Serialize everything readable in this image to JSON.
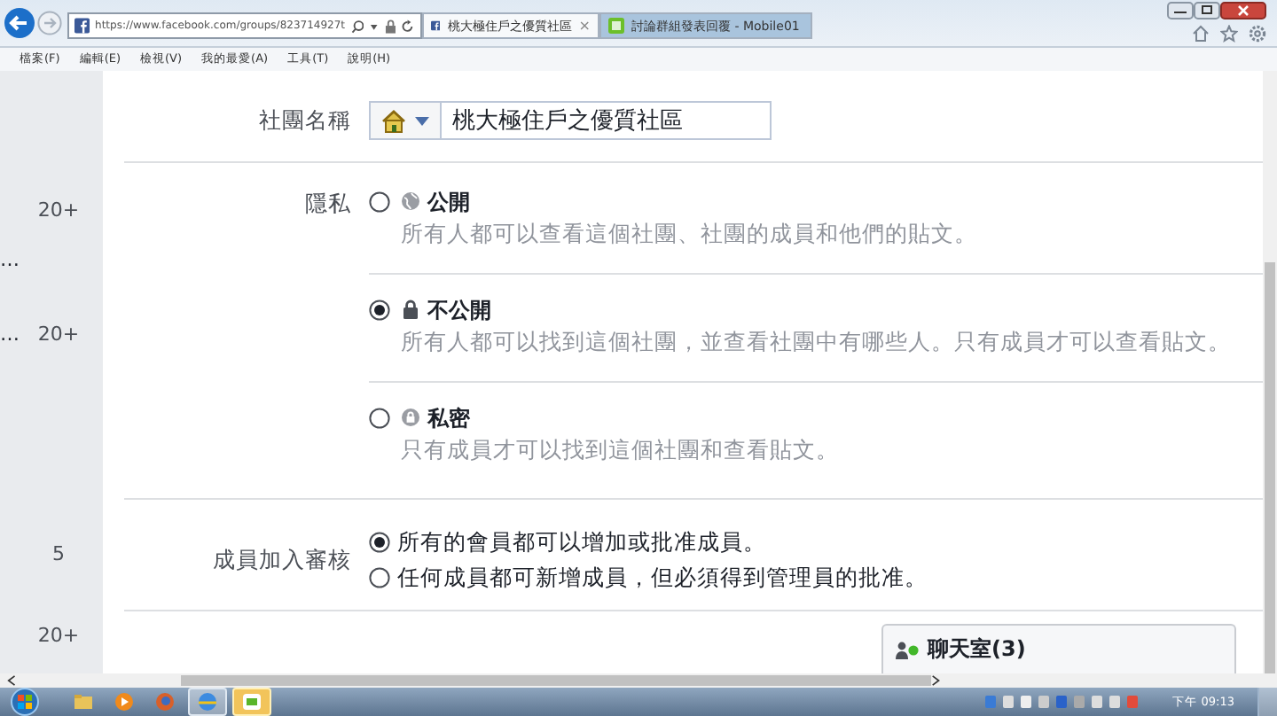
{
  "browser": {
    "address": "https://www.facebook.com/groups/823714927t",
    "tabs": [
      {
        "title": "桃大極住戶之優質社區",
        "close": "×",
        "selected": true
      },
      {
        "title": "討論群組發表回覆 - Mobile01",
        "selected": false
      }
    ],
    "menu": [
      "檔案(F)",
      "編輯(E)",
      "檢視(V)",
      "我的最愛(A)",
      "工具(T)",
      "說明(H)"
    ]
  },
  "sidebar": {
    "rows": [
      {
        "count": "20+"
      },
      {
        "ellipsis": "…"
      },
      {
        "ellipsis": "…",
        "count": "20+"
      },
      {
        "count": "5"
      },
      {
        "count": "20+"
      }
    ]
  },
  "form": {
    "group_name": {
      "label": "社團名稱",
      "value": "桃大極住戶之優質社區"
    },
    "privacy": {
      "label": "隱私",
      "options": [
        {
          "kind": "globe",
          "title": "公開",
          "description": "所有人都可以查看這個社團、社團的成員和他們的貼文。",
          "selected": false
        },
        {
          "kind": "lock",
          "title": "不公開",
          "description": "所有人都可以找到這個社團，並查看社團中有哪些人。只有成員才可以查看貼文。",
          "selected": true
        },
        {
          "kind": "private",
          "title": "私密",
          "description": "只有成員才可以找到這個社團和查看貼文。",
          "selected": false
        }
      ]
    },
    "membership": {
      "label": "成員加入審核",
      "options": [
        {
          "text": "所有的會員都可以增加或批准成員。",
          "selected": true
        },
        {
          "text": "任何成員都可新增成員，但必須得到管理員的批准。",
          "selected": false
        }
      ]
    }
  },
  "chat": {
    "title": "聊天室(3)"
  },
  "taskbar": {
    "clock": "下午 09:13"
  }
}
